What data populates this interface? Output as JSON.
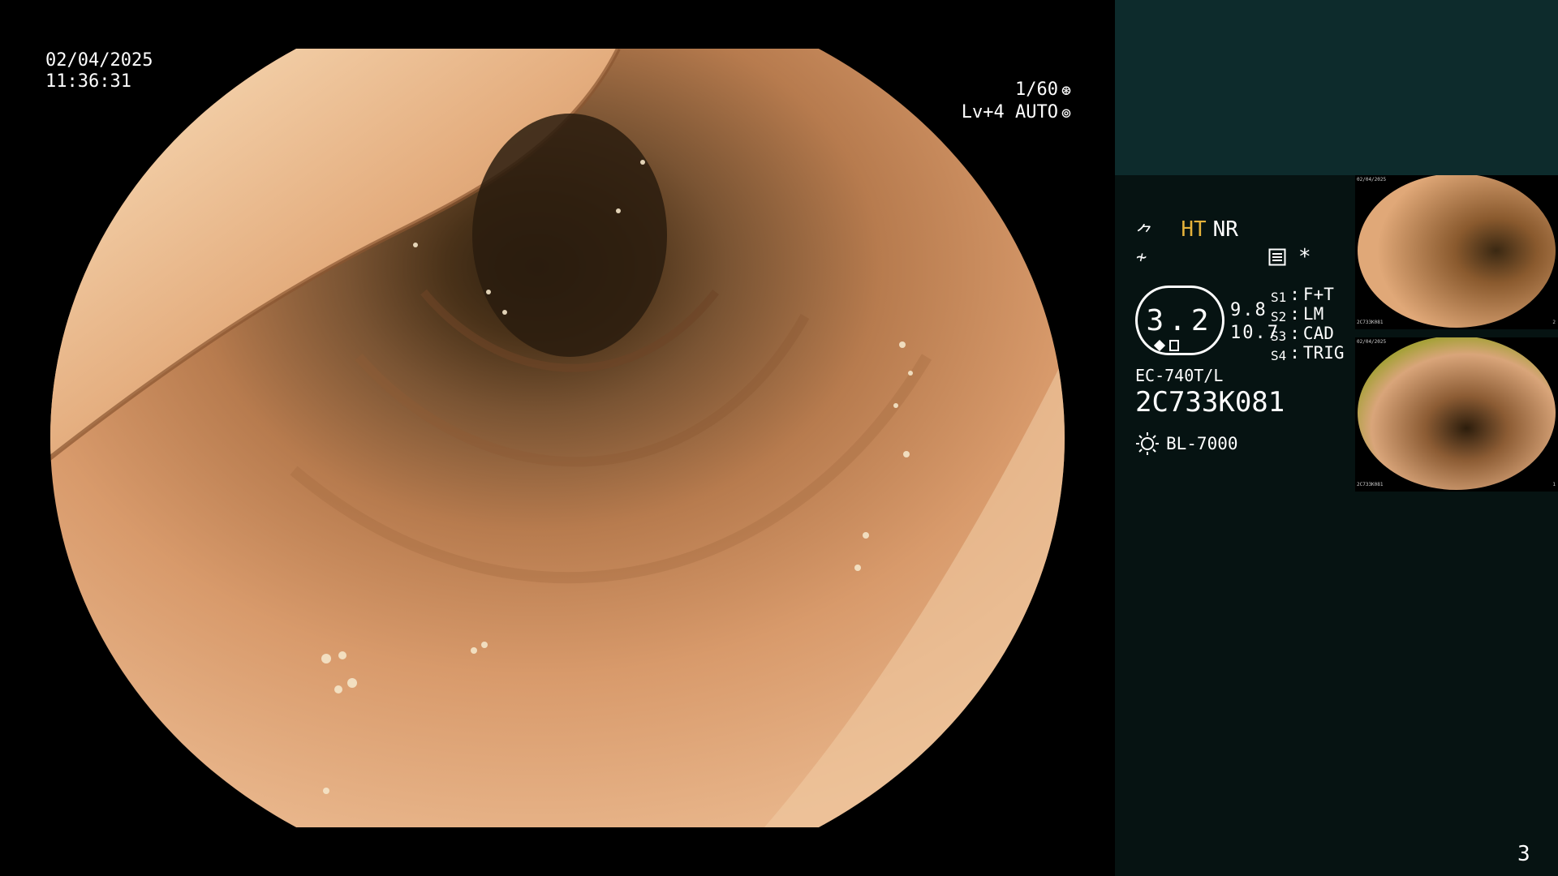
{
  "overlay": {
    "date": "02/04/2025",
    "time": "11:36:31",
    "shutter": "1/60",
    "shutter_icon": "shutter-icon",
    "iris": "Lv+4 AUTO",
    "iris_icon": "iris-icon"
  },
  "panel": {
    "mode_primary": "HT",
    "mode_primary_color": "#e4b23a",
    "mode_secondary": "NR",
    "structure_icon_glyph": "⺈",
    "color_icon_glyph": "≁",
    "zoom": "3.2",
    "value_a": "9.8",
    "value_b": "10.7",
    "record_icon": "record-icon",
    "asterisk": "*",
    "switches": [
      {
        "key": "S1",
        "value": "F+T"
      },
      {
        "key": "S2",
        "value": "LM"
      },
      {
        "key": "S3",
        "value": "CAD"
      },
      {
        "key": "S4",
        "value": "TRIG"
      }
    ],
    "scope_model": "EC-740T/L",
    "scope_serial": "2C733K081",
    "light_source": "BL-7000",
    "light_icon": "light-source-icon"
  },
  "thumbnails": [
    {
      "date": "02/04/2025",
      "serial": "2C733K081",
      "index": "2"
    },
    {
      "date": "02/04/2025",
      "serial": "2C733K081",
      "index": "1"
    }
  ],
  "page_number": "3",
  "colors": {
    "panel_top": "#0d2b2c",
    "panel_bottom": "#061312",
    "mucosa": "#c98a57"
  }
}
